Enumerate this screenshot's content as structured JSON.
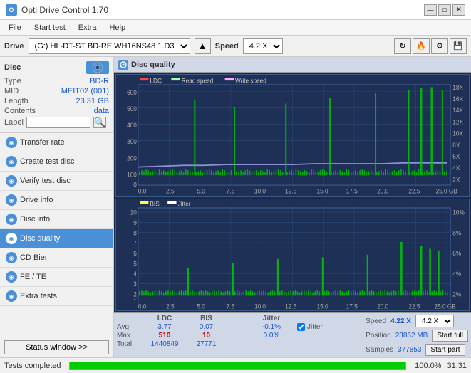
{
  "titleBar": {
    "appName": "Opti Drive Control 1.70",
    "minimize": "—",
    "maximize": "□",
    "close": "✕"
  },
  "menuBar": {
    "items": [
      "File",
      "Start test",
      "Extra",
      "Help"
    ]
  },
  "driveBar": {
    "driveLabel": "Drive",
    "driveValue": "(G:)  HL-DT-ST BD-RE  WH16NS48 1.D3",
    "speedLabel": "Speed",
    "speedValue": "4.2 X"
  },
  "disc": {
    "title": "Disc",
    "type": {
      "key": "Type",
      "val": "BD-R"
    },
    "mid": {
      "key": "MID",
      "val": "MEIT02 (001)"
    },
    "length": {
      "key": "Length",
      "val": "23.31 GB"
    },
    "contents": {
      "key": "Contents",
      "val": "data"
    },
    "label": {
      "key": "Label",
      "val": ""
    }
  },
  "nav": {
    "items": [
      {
        "id": "transfer-rate",
        "label": "Transfer rate",
        "active": false
      },
      {
        "id": "create-test-disc",
        "label": "Create test disc",
        "active": false
      },
      {
        "id": "verify-test-disc",
        "label": "Verify test disc",
        "active": false
      },
      {
        "id": "drive-info",
        "label": "Drive info",
        "active": false
      },
      {
        "id": "disc-info",
        "label": "Disc info",
        "active": false
      },
      {
        "id": "disc-quality",
        "label": "Disc quality",
        "active": true
      },
      {
        "id": "cd-bier",
        "label": "CD Bier",
        "active": false
      },
      {
        "id": "fe-te",
        "label": "FE / TE",
        "active": false
      },
      {
        "id": "extra-tests",
        "label": "Extra tests",
        "active": false
      }
    ],
    "statusBtn": "Status window >>"
  },
  "chart": {
    "title": "Disc quality",
    "topChart": {
      "legend": [
        {
          "id": "ldc",
          "label": "LDC",
          "color": "#ff4444"
        },
        {
          "id": "read",
          "label": "Read speed",
          "color": "#aaffaa"
        },
        {
          "id": "write",
          "label": "Write speed",
          "color": "#ffaaff"
        }
      ],
      "yLabels": [
        "600",
        "500",
        "400",
        "300",
        "200",
        "100",
        "0"
      ],
      "yLabelsRight": [
        "18X",
        "16X",
        "14X",
        "12X",
        "10X",
        "8X",
        "6X",
        "4X",
        "2X"
      ],
      "xLabels": [
        "0.0",
        "2.5",
        "5.0",
        "7.5",
        "10.0",
        "12.5",
        "15.0",
        "17.5",
        "20.0",
        "22.5",
        "25.0 GB"
      ]
    },
    "bottomChart": {
      "legend": [
        {
          "id": "bis",
          "label": "BIS",
          "color": "#ffff44"
        },
        {
          "id": "jitter",
          "label": "Jitter",
          "color": "#ffffff"
        }
      ],
      "yLabels": [
        "10",
        "9",
        "8",
        "7",
        "6",
        "5",
        "4",
        "3",
        "2",
        "1"
      ],
      "yLabelsRight": [
        "10%",
        "8%",
        "6%",
        "4%",
        "2%"
      ],
      "xLabels": [
        "0.0",
        "2.5",
        "5.0",
        "7.5",
        "10.0",
        "12.5",
        "15.0",
        "17.5",
        "20.0",
        "22.5",
        "25.0 GB"
      ]
    }
  },
  "stats": {
    "headers": [
      "LDC",
      "BIS",
      "",
      "Jitter",
      "Speed",
      ""
    ],
    "rows": [
      {
        "label": "Avg",
        "ldc": "3.77",
        "bis": "0.07",
        "jitter": "-0.1%",
        "speed": "4.22 X"
      },
      {
        "label": "Max",
        "ldc": "510",
        "bis": "10",
        "jitter": "0.0%",
        "position": "23862 MB"
      },
      {
        "label": "Total",
        "ldc": "1440849",
        "bis": "27771",
        "jitter": "",
        "samples": "377853"
      }
    ],
    "jitterLabel": "Jitter",
    "speedLabel": "Speed",
    "speedVal": "4.22 X",
    "speedDropdown": "4.2 X",
    "positionLabel": "Position",
    "positionVal": "23862 MB",
    "samplesLabel": "Samples",
    "samplesVal": "377853",
    "startFull": "Start full",
    "startPart": "Start part"
  },
  "statusBar": {
    "text": "Tests completed",
    "progress": 100,
    "time": "31:31"
  }
}
